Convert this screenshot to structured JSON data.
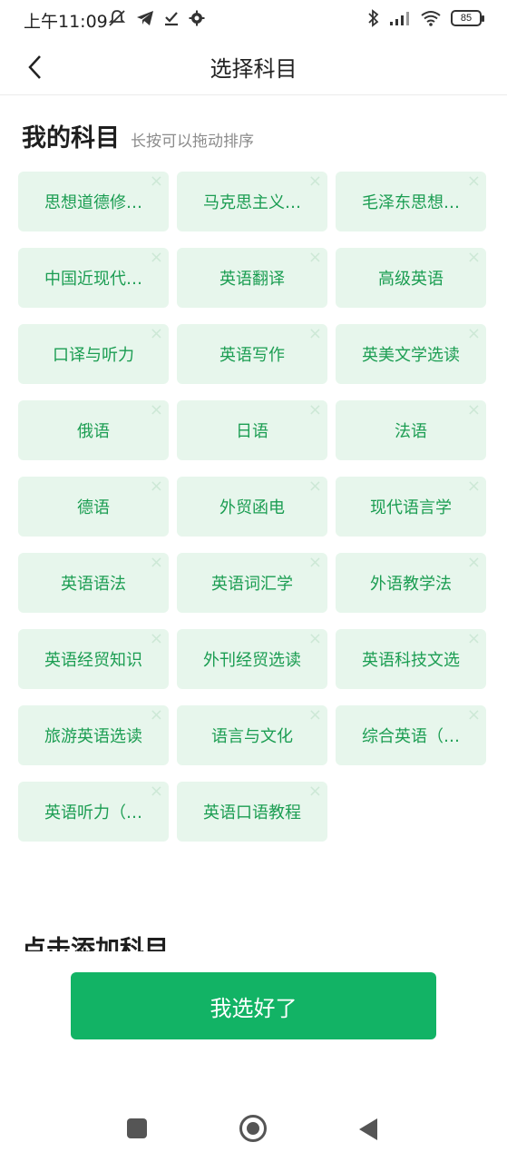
{
  "status_bar": {
    "time": "上午11:09",
    "battery": "85",
    "icons": [
      "mute-bell-icon",
      "telegram-icon",
      "download-check-icon",
      "settings-gear-icon",
      "bluetooth-icon",
      "signal-icon",
      "wifi-icon",
      "battery-icon"
    ]
  },
  "header": {
    "title": "选择科目"
  },
  "my_subjects": {
    "title": "我的科目",
    "hint": "长按可以拖动排序",
    "remove_symbol": "×",
    "items": [
      "思想道德修…",
      "马克思主义…",
      "毛泽东思想…",
      "中国近现代…",
      "英语翻译",
      "高级英语",
      "口译与听力",
      "英语写作",
      "英美文学选读",
      "俄语",
      "日语",
      "法语",
      "德语",
      "外贸函电",
      "现代语言学",
      "英语语法",
      "英语词汇学",
      "外语教学法",
      "英语经贸知识",
      "外刊经贸选读",
      "英语科技文选",
      "旅游英语选读",
      "语言与文化",
      "综合英语（…",
      "英语听力（…",
      "英语口语教程"
    ]
  },
  "add_section": {
    "title": "点击添加科目"
  },
  "confirm_button": "我选好了",
  "system_nav": [
    "recents-square-icon",
    "home-circle-icon",
    "back-triangle-icon"
  ],
  "colors": {
    "accent": "#12b365",
    "chip_bg": "#e7f6ec",
    "chip_text": "#1b9d52"
  }
}
